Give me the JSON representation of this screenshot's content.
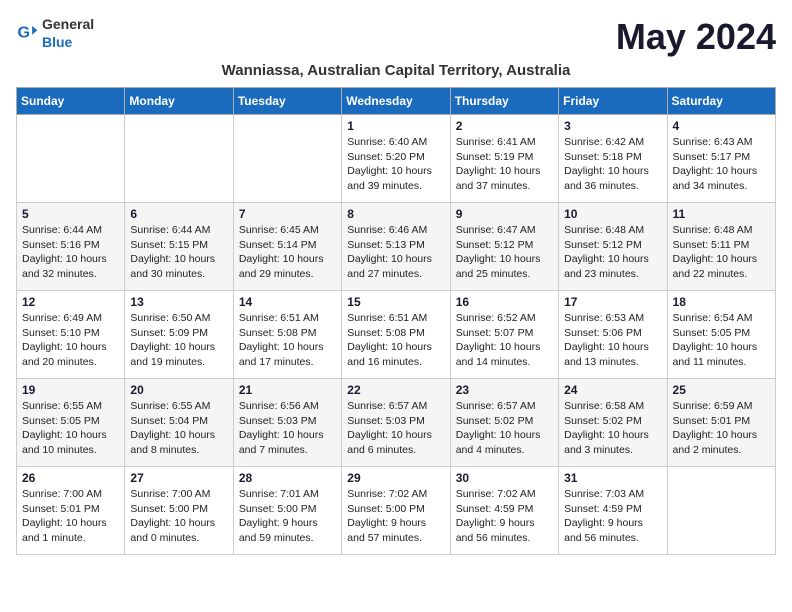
{
  "logo": {
    "text_general": "General",
    "text_blue": "Blue"
  },
  "title": "May 2024",
  "subtitle": "Wanniassa, Australian Capital Territory, Australia",
  "days_of_week": [
    "Sunday",
    "Monday",
    "Tuesday",
    "Wednesday",
    "Thursday",
    "Friday",
    "Saturday"
  ],
  "weeks": [
    [
      {
        "day": "",
        "info": ""
      },
      {
        "day": "",
        "info": ""
      },
      {
        "day": "",
        "info": ""
      },
      {
        "day": "1",
        "info": "Sunrise: 6:40 AM\nSunset: 5:20 PM\nDaylight: 10 hours\nand 39 minutes."
      },
      {
        "day": "2",
        "info": "Sunrise: 6:41 AM\nSunset: 5:19 PM\nDaylight: 10 hours\nand 37 minutes."
      },
      {
        "day": "3",
        "info": "Sunrise: 6:42 AM\nSunset: 5:18 PM\nDaylight: 10 hours\nand 36 minutes."
      },
      {
        "day": "4",
        "info": "Sunrise: 6:43 AM\nSunset: 5:17 PM\nDaylight: 10 hours\nand 34 minutes."
      }
    ],
    [
      {
        "day": "5",
        "info": "Sunrise: 6:44 AM\nSunset: 5:16 PM\nDaylight: 10 hours\nand 32 minutes."
      },
      {
        "day": "6",
        "info": "Sunrise: 6:44 AM\nSunset: 5:15 PM\nDaylight: 10 hours\nand 30 minutes."
      },
      {
        "day": "7",
        "info": "Sunrise: 6:45 AM\nSunset: 5:14 PM\nDaylight: 10 hours\nand 29 minutes."
      },
      {
        "day": "8",
        "info": "Sunrise: 6:46 AM\nSunset: 5:13 PM\nDaylight: 10 hours\nand 27 minutes."
      },
      {
        "day": "9",
        "info": "Sunrise: 6:47 AM\nSunset: 5:12 PM\nDaylight: 10 hours\nand 25 minutes."
      },
      {
        "day": "10",
        "info": "Sunrise: 6:48 AM\nSunset: 5:12 PM\nDaylight: 10 hours\nand 23 minutes."
      },
      {
        "day": "11",
        "info": "Sunrise: 6:48 AM\nSunset: 5:11 PM\nDaylight: 10 hours\nand 22 minutes."
      }
    ],
    [
      {
        "day": "12",
        "info": "Sunrise: 6:49 AM\nSunset: 5:10 PM\nDaylight: 10 hours\nand 20 minutes."
      },
      {
        "day": "13",
        "info": "Sunrise: 6:50 AM\nSunset: 5:09 PM\nDaylight: 10 hours\nand 19 minutes."
      },
      {
        "day": "14",
        "info": "Sunrise: 6:51 AM\nSunset: 5:08 PM\nDaylight: 10 hours\nand 17 minutes."
      },
      {
        "day": "15",
        "info": "Sunrise: 6:51 AM\nSunset: 5:08 PM\nDaylight: 10 hours\nand 16 minutes."
      },
      {
        "day": "16",
        "info": "Sunrise: 6:52 AM\nSunset: 5:07 PM\nDaylight: 10 hours\nand 14 minutes."
      },
      {
        "day": "17",
        "info": "Sunrise: 6:53 AM\nSunset: 5:06 PM\nDaylight: 10 hours\nand 13 minutes."
      },
      {
        "day": "18",
        "info": "Sunrise: 6:54 AM\nSunset: 5:05 PM\nDaylight: 10 hours\nand 11 minutes."
      }
    ],
    [
      {
        "day": "19",
        "info": "Sunrise: 6:55 AM\nSunset: 5:05 PM\nDaylight: 10 hours\nand 10 minutes."
      },
      {
        "day": "20",
        "info": "Sunrise: 6:55 AM\nSunset: 5:04 PM\nDaylight: 10 hours\nand 8 minutes."
      },
      {
        "day": "21",
        "info": "Sunrise: 6:56 AM\nSunset: 5:03 PM\nDaylight: 10 hours\nand 7 minutes."
      },
      {
        "day": "22",
        "info": "Sunrise: 6:57 AM\nSunset: 5:03 PM\nDaylight: 10 hours\nand 6 minutes."
      },
      {
        "day": "23",
        "info": "Sunrise: 6:57 AM\nSunset: 5:02 PM\nDaylight: 10 hours\nand 4 minutes."
      },
      {
        "day": "24",
        "info": "Sunrise: 6:58 AM\nSunset: 5:02 PM\nDaylight: 10 hours\nand 3 minutes."
      },
      {
        "day": "25",
        "info": "Sunrise: 6:59 AM\nSunset: 5:01 PM\nDaylight: 10 hours\nand 2 minutes."
      }
    ],
    [
      {
        "day": "26",
        "info": "Sunrise: 7:00 AM\nSunset: 5:01 PM\nDaylight: 10 hours\nand 1 minute."
      },
      {
        "day": "27",
        "info": "Sunrise: 7:00 AM\nSunset: 5:00 PM\nDaylight: 10 hours\nand 0 minutes."
      },
      {
        "day": "28",
        "info": "Sunrise: 7:01 AM\nSunset: 5:00 PM\nDaylight: 9 hours\nand 59 minutes."
      },
      {
        "day": "29",
        "info": "Sunrise: 7:02 AM\nSunset: 5:00 PM\nDaylight: 9 hours\nand 57 minutes."
      },
      {
        "day": "30",
        "info": "Sunrise: 7:02 AM\nSunset: 4:59 PM\nDaylight: 9 hours\nand 56 minutes."
      },
      {
        "day": "31",
        "info": "Sunrise: 7:03 AM\nSunset: 4:59 PM\nDaylight: 9 hours\nand 56 minutes."
      },
      {
        "day": "",
        "info": ""
      }
    ]
  ]
}
